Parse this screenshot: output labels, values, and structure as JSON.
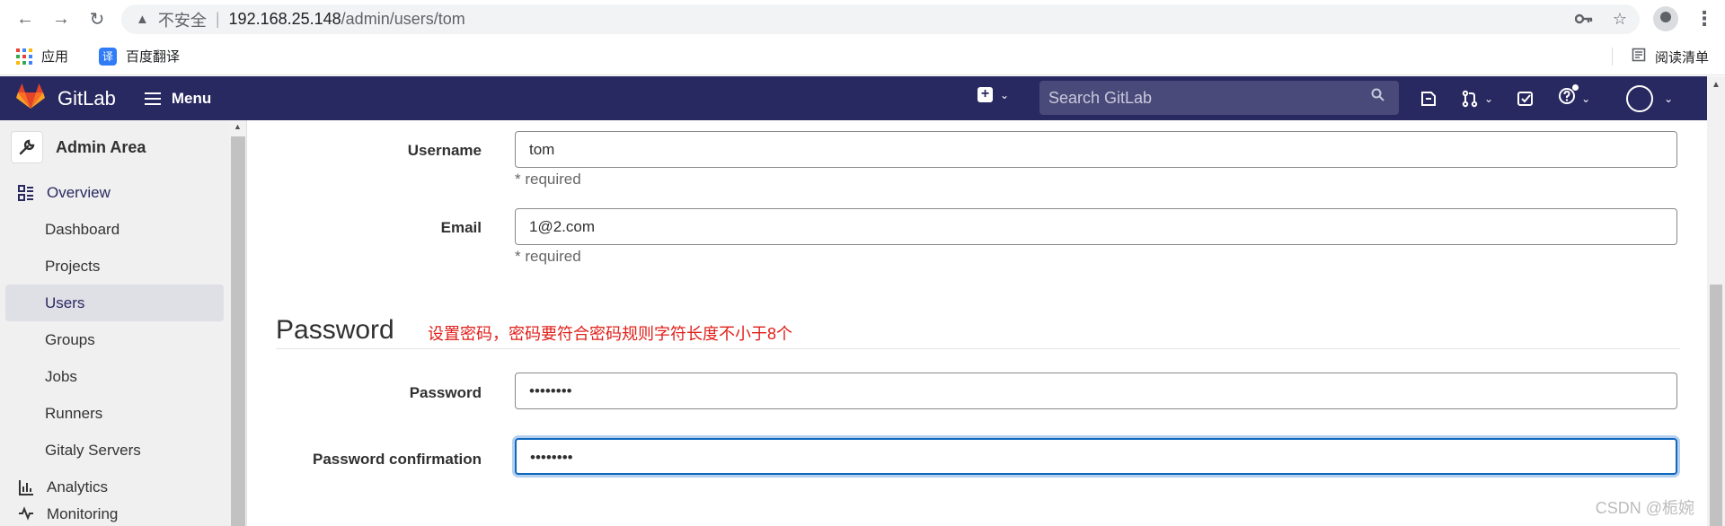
{
  "browser": {
    "warning_text": "不安全",
    "url_host": "192.168.25.148",
    "url_path": "/admin/users/tom",
    "bookmarks": [
      {
        "label": "应用"
      },
      {
        "label": "百度翻译"
      }
    ],
    "reading_list_label": "阅读清单"
  },
  "header": {
    "brand": "GitLab",
    "menu_label": "Menu",
    "search_placeholder": "Search GitLab"
  },
  "sidebar": {
    "context_title": "Admin Area",
    "section_overview": "Overview",
    "items": [
      {
        "label": "Dashboard"
      },
      {
        "label": "Projects"
      },
      {
        "label": "Users"
      },
      {
        "label": "Groups"
      },
      {
        "label": "Jobs"
      },
      {
        "label": "Runners"
      },
      {
        "label": "Gitaly Servers"
      }
    ],
    "section_analytics": "Analytics",
    "section_monitoring": "Monitoring"
  },
  "form": {
    "username_label": "Username",
    "username_value": "tom",
    "username_help": "* required",
    "email_label": "Email",
    "email_value": "1@2.com",
    "email_help": "* required",
    "password_section_title": "Password",
    "annotation": "设置密码，密码要符合密码规则字符长度不小于8个",
    "password_label": "Password",
    "password_value": "••••••••",
    "password_confirm_label": "Password confirmation",
    "password_confirm_value": "••••••••"
  },
  "watermark": "CSDN @栀婉",
  "colors": {
    "header_bg": "#292961",
    "annotation": "#e0201a",
    "focus_border": "#1068bf"
  }
}
